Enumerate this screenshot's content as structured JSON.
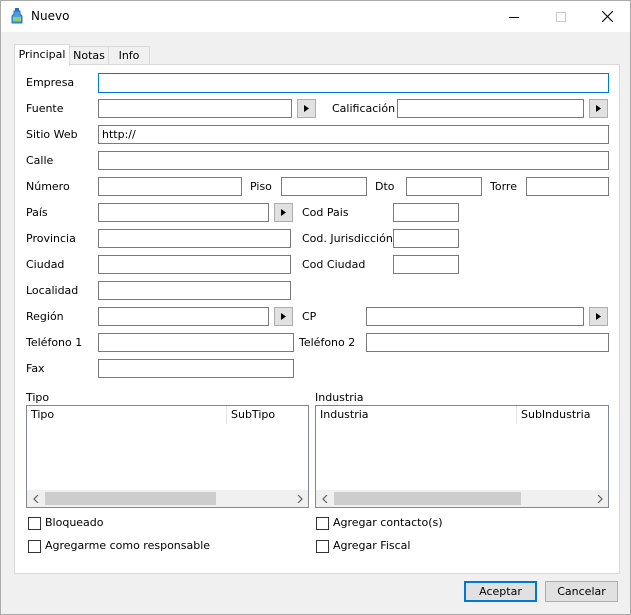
{
  "window": {
    "title": "Nuevo",
    "icon": "bottle-icon"
  },
  "tabs": [
    {
      "label": "Principal",
      "active": true
    },
    {
      "label": "Notas",
      "active": false
    },
    {
      "label": "Info",
      "active": false
    }
  ],
  "form": {
    "empresa": {
      "label": "Empresa",
      "value": ""
    },
    "fuente": {
      "label": "Fuente",
      "value": ""
    },
    "calificacion": {
      "label": "Calificación",
      "value": ""
    },
    "sitio_web": {
      "label": "Sitio Web",
      "value": "http://"
    },
    "calle": {
      "label": "Calle",
      "value": ""
    },
    "numero": {
      "label": "Número",
      "value": ""
    },
    "piso": {
      "label": "Piso",
      "value": ""
    },
    "dto": {
      "label": "Dto",
      "value": ""
    },
    "torre": {
      "label": "Torre",
      "value": ""
    },
    "pais": {
      "label": "País",
      "value": ""
    },
    "cod_pais": {
      "label": "Cod Pais",
      "value": ""
    },
    "provincia": {
      "label": "Provincia",
      "value": ""
    },
    "cod_jurisdiccion": {
      "label": "Cod. Jurisdicción",
      "value": ""
    },
    "ciudad": {
      "label": "Ciudad",
      "value": ""
    },
    "cod_ciudad": {
      "label": "Cod Ciudad",
      "value": ""
    },
    "localidad": {
      "label": "Localidad",
      "value": ""
    },
    "region": {
      "label": "Región",
      "value": ""
    },
    "cp": {
      "label": "CP",
      "value": ""
    },
    "telefono1": {
      "label": "Teléfono 1",
      "value": ""
    },
    "telefono2": {
      "label": "Teléfono 2",
      "value": ""
    },
    "fax": {
      "label": "Fax",
      "value": ""
    }
  },
  "tipo": {
    "label": "Tipo",
    "columns": [
      "Tipo",
      "SubTipo"
    ],
    "rows": []
  },
  "industria": {
    "label": "Industria",
    "columns": [
      "Industria",
      "SubIndustria"
    ],
    "rows": []
  },
  "checkboxes": {
    "bloqueado": {
      "label": "Bloqueado",
      "checked": false
    },
    "responsable": {
      "label": "Agregarme como responsable",
      "checked": false
    },
    "contacto": {
      "label": "Agregar contacto(s)",
      "checked": false
    },
    "fiscal": {
      "label": "Agregar Fiscal",
      "checked": false
    }
  },
  "buttons": {
    "accept": "Aceptar",
    "cancel": "Cancelar"
  },
  "colors": {
    "focus_border": "#0078d7",
    "panel_bg": "#ffffff",
    "window_bg": "#f0f0f0"
  }
}
